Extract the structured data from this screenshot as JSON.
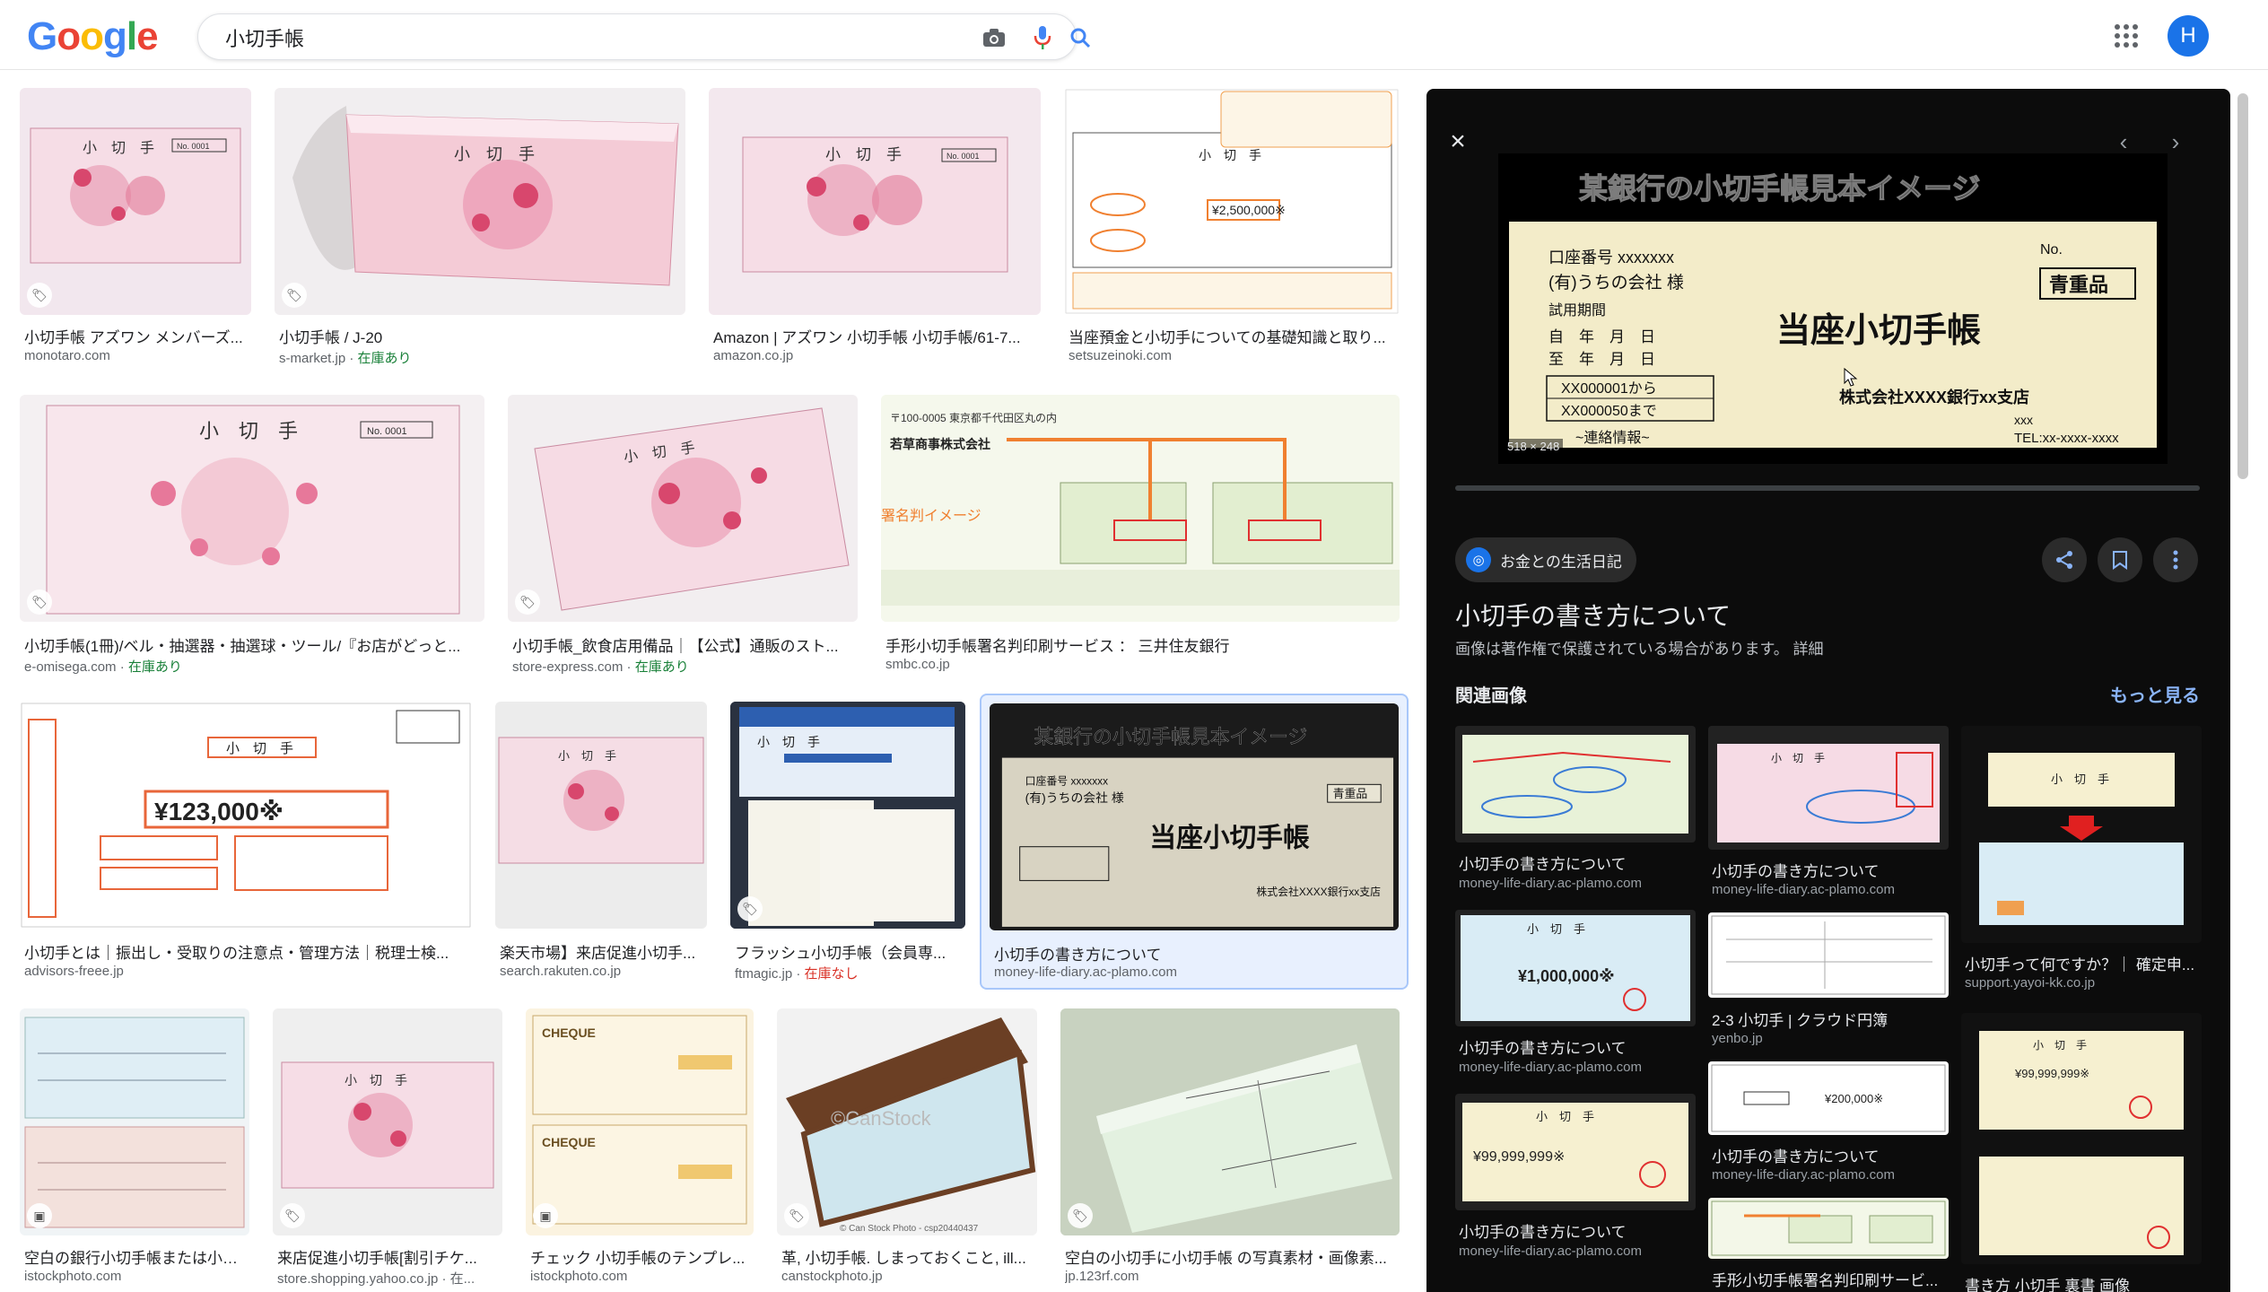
{
  "header": {
    "logo": "Google",
    "search_value": "小切手帳",
    "avatar_letter": "H"
  },
  "results": [
    {
      "caption": "小切手帳 アズワン メンバーズ...",
      "source": "monotaro.com",
      "stock": ""
    },
    {
      "caption": "小切手帳 / J-20",
      "source": "s-market.jp",
      "stock": "在庫あり"
    },
    {
      "caption": "Amazon | アズワン 小切手帳 小切手帳/61-7...",
      "source": "amazon.co.jp",
      "stock": ""
    },
    {
      "caption": "当座預金と小切手についての基礎知識と取り...",
      "source": "setsuzeinoki.com",
      "stock": ""
    },
    {
      "caption": "小切手帳(1冊)/ベル・抽選器・抽選球・ツール/『お店がどっと...",
      "source": "e-omisega.com",
      "stock": "在庫あり"
    },
    {
      "caption": "小切手帳_飲食店用備品｜【公式】通販のスト...",
      "source": "store-express.com",
      "stock": "在庫あり"
    },
    {
      "caption": "手形小切手帳署名判印刷サービス ： 三井住友銀行",
      "source": "smbc.co.jp",
      "stock": ""
    },
    {
      "caption": "小切手とは｜振出し・受取りの注意点・管理方法｜税理士検...",
      "source": "advisors-freee.jp",
      "stock": ""
    },
    {
      "caption": "楽天市場】来店促進小切手...",
      "source": "search.rakuten.co.jp",
      "stock": ""
    },
    {
      "caption": "フラッシュ小切手帳（会員専...",
      "source": "ftmagic.jp",
      "stock": "在庫なし"
    },
    {
      "caption": "小切手の書き方について",
      "source": "money-life-diary.ac-plamo.com",
      "stock": ""
    },
    {
      "caption": "空白の銀行小切手帳または小切...",
      "source": "istockphoto.com",
      "stock": ""
    },
    {
      "caption": "来店促進小切手帳[割引チケ...",
      "source": "store.shopping.yahoo.co.jp · 在...",
      "stock": ""
    },
    {
      "caption": "チェック 小切手帳のテンプレ...",
      "source": "istockphoto.com",
      "stock": ""
    },
    {
      "caption": "革, 小切手帳. しまっておくこと, ill...",
      "source": "canstockphoto.jp",
      "stock": ""
    },
    {
      "caption": "空白の小切手に小切手帳 の写真素材・画像素...",
      "source": "jp.123rf.com",
      "stock": ""
    }
  ],
  "thumb_text": {
    "check": "小　切　手",
    "no": "No. 0001",
    "amount": "¥2,500,000※",
    "amount2": "¥123,000※",
    "sign_image": "署名判イメージ",
    "canstock": "©CanStock",
    "canstock_credit": "© Can Stock Photo - csp20440437",
    "cheque": "CHEQUE"
  },
  "panel": {
    "preview": {
      "header": "某銀行の小切手帳見本イメージ",
      "account": "口座番号 xxxxxxx",
      "company": "(有)うちの会社 様",
      "trial": "試用期間",
      "from_label": "自　年　月　日",
      "to_label": "至　年　月　日",
      "no_label": "No.",
      "stamp": "青重品",
      "title": "当座小切手帳",
      "serial_from": "XX000001から",
      "serial_to": "XX000050まで",
      "bank": "株式会社XXXX銀行xx支店",
      "branch": "xxx",
      "tel": "TEL:xx-xxxx-xxxx",
      "contact": "~連絡情報~"
    },
    "image_size": "518 × 248",
    "source_name": "お金との生活日記",
    "title": "小切手の書き方について",
    "notice": "画像は著作権で保護されている場合があります。",
    "notice_link": "詳細",
    "related_heading": "関連画像",
    "more_link": "もっと見る",
    "related": [
      {
        "caption": "小切手の書き方について",
        "source": "money-life-diary.ac-plamo.com"
      },
      {
        "caption": "小切手の書き方について",
        "source": "money-life-diary.ac-plamo.com"
      },
      {
        "caption": "小切手の書き方について",
        "source": "money-life-diary.ac-plamo.com"
      },
      {
        "caption": "小切手の書き方について",
        "source": "money-life-diary.ac-plamo.com"
      },
      {
        "caption": "2-3 小切手 | クラウド円簿",
        "source": "yenbo.jp"
      },
      {
        "caption": "小切手の書き方について",
        "source": "money-life-diary.ac-plamo.com"
      },
      {
        "caption": "小切手って何ですか？｜ 確定申...",
        "source": "support.yayoi-kk.co.jp"
      },
      {
        "caption": "小切手の書き方について",
        "source": "money-life-diary.ac-plamo.com"
      },
      {
        "caption": "手形小切手帳署名判印刷サービ...",
        "source": ""
      },
      {
        "caption": "書き方 小切手 裏書 画像",
        "source": ""
      }
    ],
    "related_thumb_text": {
      "check": "小　切　手",
      "amount": "¥1,000,000※",
      "amount2": "¥99,999,999※",
      "amount3": "¥200,000※"
    }
  }
}
